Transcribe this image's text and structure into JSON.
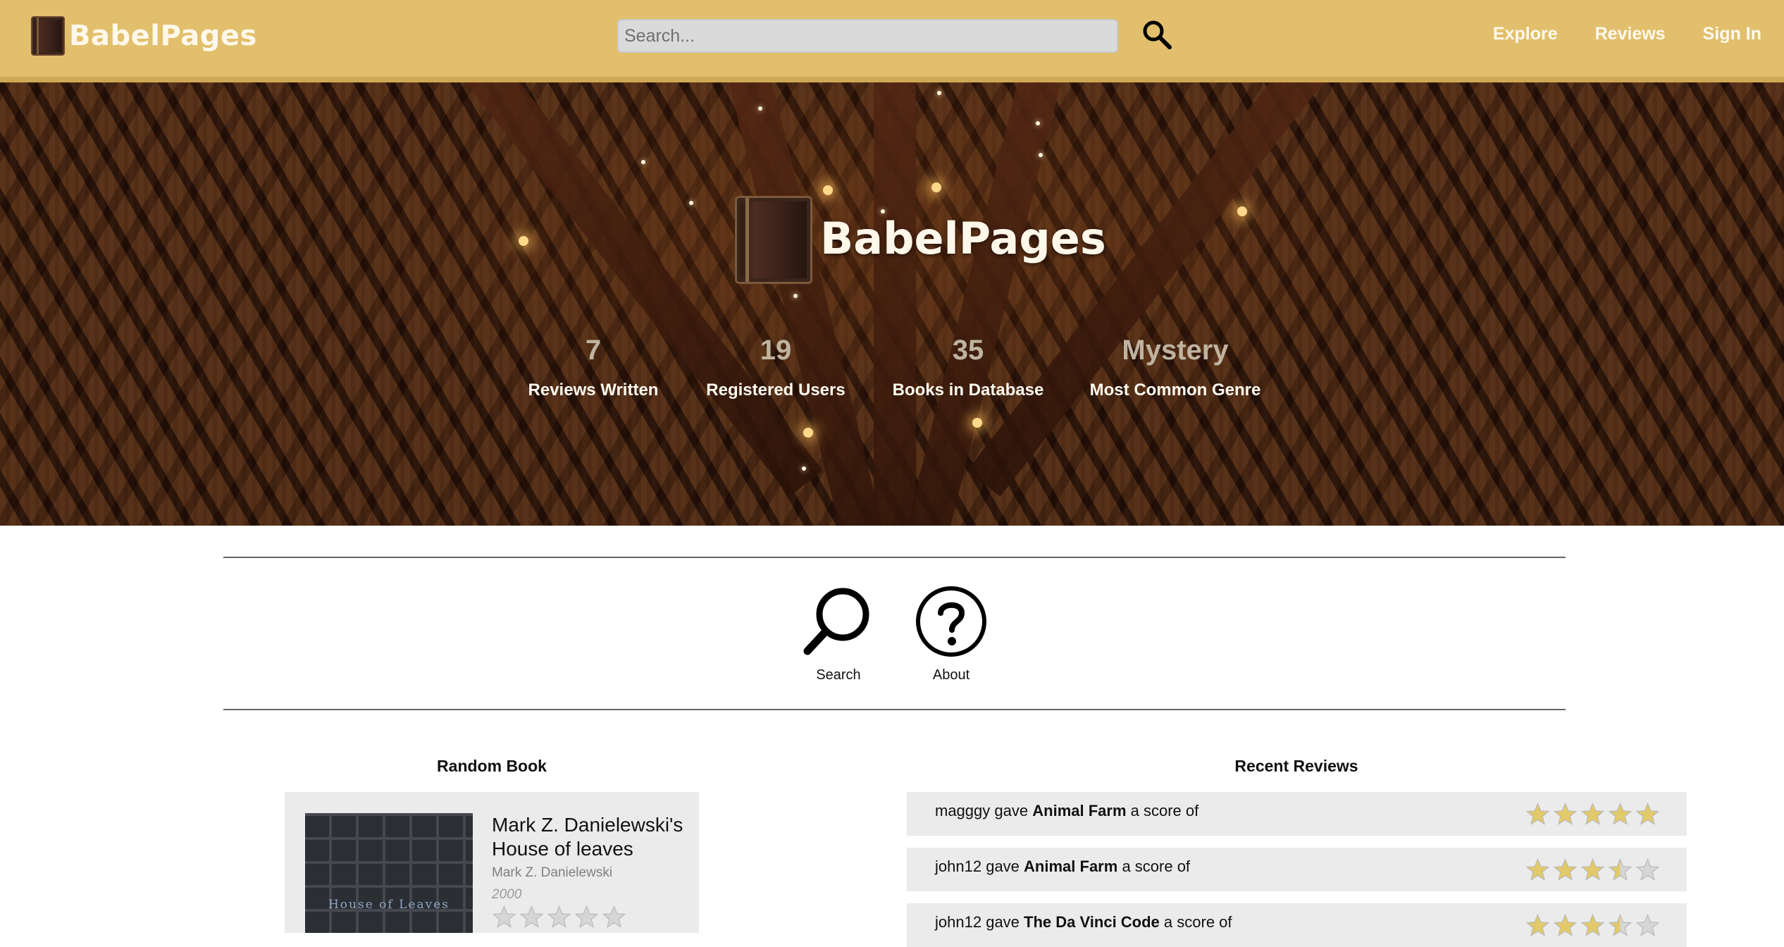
{
  "navbar": {
    "brand": "BabelPages",
    "search_placeholder": "Search...",
    "links": [
      "Explore",
      "Reviews",
      "Sign In"
    ]
  },
  "icons": {
    "logo": "book-icon",
    "search": "search-icon",
    "about": "question-circle-icon",
    "star": "star-icon"
  },
  "hero": {
    "title": "BabelPages",
    "stats": [
      {
        "value": "7",
        "label": "Reviews Written"
      },
      {
        "value": "19",
        "label": "Registered Users"
      },
      {
        "value": "35",
        "label": "Books in Database"
      },
      {
        "value": "Mystery",
        "label": "Most Common Genre"
      }
    ]
  },
  "quick_links": {
    "search_label": "Search",
    "about_label": "About"
  },
  "random_book": {
    "heading": "Random Book",
    "cover_text": "House of Leaves",
    "title": "Mark Z. Danielewski's House of leaves",
    "author": "Mark Z. Danielewski",
    "year": "2000",
    "rating_stars": 0
  },
  "recent_reviews": {
    "heading": "Recent Reviews",
    "score_phrase": "a score of",
    "items": [
      {
        "user": "magggy",
        "verb": "gave",
        "book": "Animal Farm",
        "score": 5
      },
      {
        "user": "john12",
        "verb": "gave",
        "book": "Animal Farm",
        "score": 3.5
      },
      {
        "user": "john12",
        "verb": "gave",
        "book": "The Da Vinci Code",
        "score": 3.5
      }
    ]
  },
  "colors": {
    "navbar": "#e2bf6c",
    "star_filled": "#e2c96a",
    "star_empty": "#d6d6d6",
    "card_bg": "#ebebeb"
  }
}
